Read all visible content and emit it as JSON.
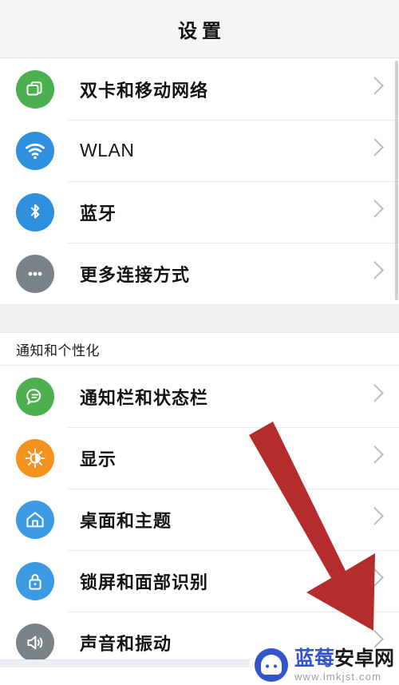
{
  "header": {
    "title": "设置"
  },
  "scroll": {
    "position_hint": "near-top"
  },
  "groups": [
    {
      "id": "connectivity",
      "section_label": "",
      "rows": [
        {
          "label": "双卡和移动网络",
          "icon": "sim-card-icon",
          "icon_color": "#4caf50",
          "script": "cjk",
          "chevron": "chevron-right-icon"
        },
        {
          "label": "WLAN",
          "icon": "wifi-icon",
          "icon_color": "#2d8fdd",
          "script": "latin",
          "chevron": "chevron-right-icon"
        },
        {
          "label": "蓝牙",
          "icon": "bluetooth-icon",
          "icon_color": "#2d8fdd",
          "script": "cjk",
          "chevron": "chevron-right-icon"
        },
        {
          "label": "更多连接方式",
          "icon": "more-dots-icon",
          "icon_color": "#7c8388",
          "script": "cjk",
          "chevron": "chevron-right-icon"
        }
      ]
    },
    {
      "id": "notifications-personalization",
      "section_label": "通知和个性化",
      "rows": [
        {
          "label": "通知栏和状态栏",
          "icon": "chat-bubble-icon",
          "icon_color": "#4caf50",
          "script": "cjk",
          "chevron": "chevron-right-icon"
        },
        {
          "label": "显示",
          "icon": "brightness-icon",
          "icon_color": "#f5921e",
          "script": "cjk",
          "chevron": "chevron-right-icon"
        },
        {
          "label": "桌面和主题",
          "icon": "home-icon",
          "icon_color": "#3b9ae1",
          "script": "cjk",
          "chevron": "chevron-right-icon"
        },
        {
          "label": "锁屏和面部识别",
          "icon": "lock-icon",
          "icon_color": "#3b9ae1",
          "script": "cjk",
          "chevron": "chevron-right-icon"
        },
        {
          "label": "声音和振动",
          "icon": "speaker-icon",
          "icon_color": "#7c8388",
          "script": "cjk",
          "chevron": "chevron-right-icon"
        }
      ]
    }
  ],
  "annotation": {
    "type": "red-arrow",
    "color": "#b52c2c",
    "points_to": "声音和振动"
  },
  "watermark": {
    "brand_blue": "蓝莓",
    "brand_dark": "安卓网",
    "url": "www.lmkjst.com",
    "logo_color": "#3355cc"
  },
  "colors": {
    "header_bg": "#f5f5f5",
    "page_bg": "#ffffff",
    "divider": "#e9ebed",
    "group_gap": "#eef0f2",
    "chevron": "#bdbdbd",
    "text_primary": "#141414",
    "arrow_red": "#b52c2c"
  }
}
